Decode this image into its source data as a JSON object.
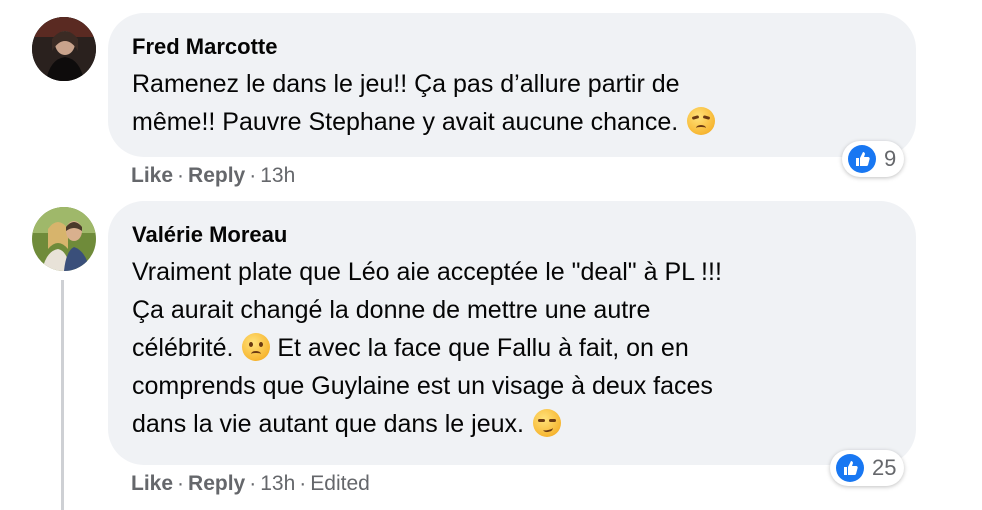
{
  "comments": [
    {
      "author": "Fred Marcotte",
      "lines": [
        "Ramenez le dans le jeu!! Ça pas d’allure partir de",
        "même!! Pauvre Stephane y avait aucune chance."
      ],
      "line_emoji": [
        null,
        "disappointed-face"
      ],
      "reaction_count": "9",
      "like_label": "Like",
      "reply_label": "Reply",
      "time": "13h",
      "edited": ""
    },
    {
      "author": "Valérie Moreau",
      "lines": [
        "Vraiment plate que Léo aie acceptée le \"deal\" à PL !!!",
        "Ça aurait changé la donne de mettre une autre",
        "célébrité.",
        " Et avec la face que Fallu à fait, on en",
        "comprends que Guylaine est un visage à deux faces",
        "dans la vie autant que dans le jeux."
      ],
      "reaction_count": "25",
      "like_label": "Like",
      "reply_label": "Reply",
      "time": "13h",
      "edited": "Edited"
    }
  ],
  "colors": {
    "bubble": "#f0f2f5",
    "like_blue": "#1877f2",
    "meta_gray": "#65676b"
  },
  "icons": [
    "avatar",
    "disappointed-face-emoji",
    "frowning-face-emoji",
    "smirking-face-emoji",
    "thumbs-up-icon"
  ]
}
